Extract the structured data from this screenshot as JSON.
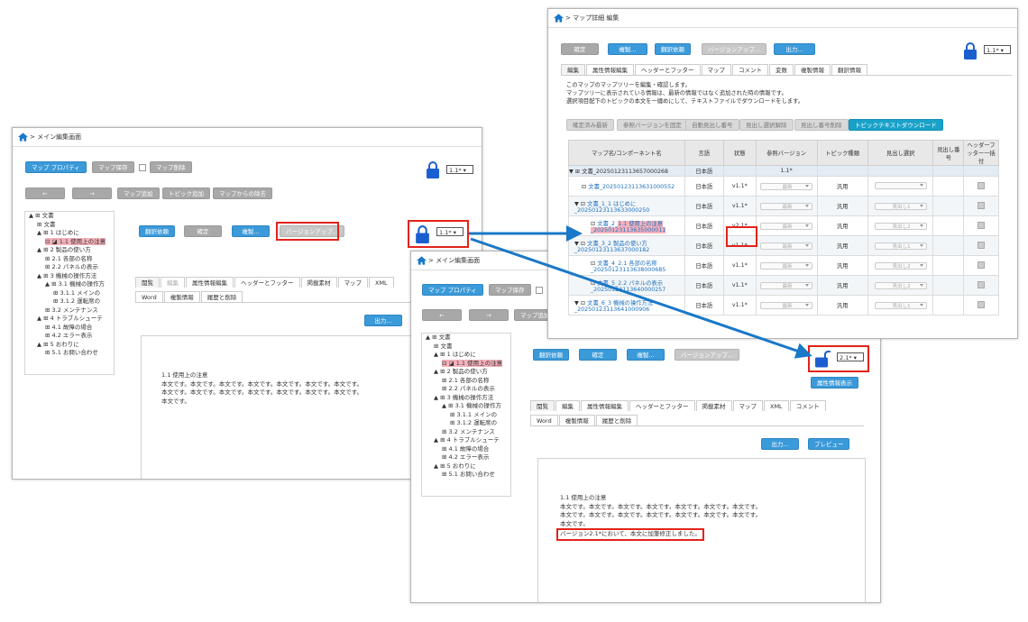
{
  "win1": {
    "title": "メイン編集画面",
    "map_prop": "マップ プロパティ",
    "map_save": "マップ保存",
    "map_delete": "マップ削除",
    "version": "1.1*",
    "back": "←",
    "forward": "→",
    "map_add": "マップ追加",
    "topic_add": "トピック追加",
    "map_remove": "マップからの除去",
    "translate": "翻訳依頼",
    "confirm": "確定",
    "duplicate": "複製...",
    "version_up": "バージョンアップ...",
    "tabs1": [
      "閲覧",
      "編集",
      "属性情報編集",
      "ヘッダーとフッター",
      "掲載素材",
      "マップ",
      "XML"
    ],
    "tabs2": [
      "Word",
      "複製情報",
      "履歴と削除"
    ],
    "output": "出力...",
    "doc_title": "1.1 使用上の注意",
    "doc_lines": [
      "本文です。本文です。本文です。本文です。本文です。本文です。本文です。",
      "本文です。本文です。本文です。本文です。本文です。本文です。本文です。",
      "本文です。"
    ]
  },
  "tree": [
    {
      "indent": 0,
      "label": "▲ ⊞ 文書"
    },
    {
      "indent": 1,
      "label": "⊞ 文書"
    },
    {
      "indent": 1,
      "label": "▲ ⊞ 1 はじめに"
    },
    {
      "indent": 2,
      "label": "1.1 使用上の注意",
      "hl": true
    },
    {
      "indent": 1,
      "label": "▲ ⊞ 2 製品の使い方"
    },
    {
      "indent": 2,
      "label": "⊞ 2.1 各部の名称"
    },
    {
      "indent": 2,
      "label": "⊞ 2.2 パネルの表示"
    },
    {
      "indent": 1,
      "label": "▲ ⊞ 3 機械の操作方法"
    },
    {
      "indent": 2,
      "label": "▲ ⊞ 3.1 機械の操作方"
    },
    {
      "indent": 3,
      "label": "⊞ 3.1.1 メインの"
    },
    {
      "indent": 3,
      "label": "⊞ 3.1.2 運転席の"
    },
    {
      "indent": 2,
      "label": "⊞ 3.2 メンテナンス"
    },
    {
      "indent": 1,
      "label": "▲ ⊞ 4 トラブルシューテ"
    },
    {
      "indent": 2,
      "label": "⊞ 4.1 故障の場合"
    },
    {
      "indent": 2,
      "label": "⊞ 4.2 エラー表示"
    },
    {
      "indent": 1,
      "label": "▲ ⊞ 5 おわりに"
    },
    {
      "indent": 2,
      "label": "⊞ 5.1 お問い合わせ"
    }
  ],
  "win2": {
    "title": "メイン編集画面",
    "map_prop": "マップ プロパティ",
    "map_save": "マップ保存",
    "back": "←",
    "forward": "→",
    "map_add": "マップ追加",
    "translate": "翻訳依頼",
    "confirm": "確定",
    "duplicate": "複製...",
    "version_up": "バージョンアップ...",
    "version": "2.1*",
    "attr_show": "属性情報表示",
    "tabs1": [
      "閲覧",
      "編集",
      "属性情報編集",
      "ヘッダーとフッター",
      "掲載素材",
      "マップ",
      "XML",
      "コメント"
    ],
    "tabs2": [
      "Word",
      "複製情報",
      "履歴と削除"
    ],
    "output": "出力...",
    "preview": "プレビュー",
    "doc_title": "1.1 使用上の注意",
    "doc_lines": [
      "本文です。本文です。本文です。本文です。本文です。本文です。本文です。",
      "本文です。本文です。本文です。本文です。本文です。本文です。本文です。",
      "本文です。"
    ],
    "edited_note": "バージョン2.1*において、本文に加筆修正しました。"
  },
  "win3": {
    "title": "マップ詳細 編集",
    "confirm": "確定",
    "duplicate": "複製...",
    "translate": "翻訳依頼",
    "version_up": "バージョンアップ...",
    "output": "出力...",
    "version": "1.1*",
    "tabs": [
      "編集",
      "属性情報編集",
      "ヘッダーとフッター",
      "マップ",
      "コメント",
      "変数",
      "複製情報",
      "翻訳情報"
    ],
    "desc": [
      "このマップのマップツリーを編集・確認します。",
      "マップツリーに表示されている情報は、最新の情報ではなく追加された時の情報です。",
      "選択項目配下のトピックの本文を一纏めにして、テキストファイルでダウンロードをします。"
    ],
    "actions": [
      "確定済み最新",
      "参照バージョンを固定",
      "自動見出し番号",
      "見出し選択解除",
      "見出し番号削除",
      "トピックテキストダウンロード"
    ],
    "headers": [
      "マップ名/コンポーネント名",
      "言語",
      "状態",
      "参照バージョン",
      "トピック種類",
      "見出し選択",
      "見出し番号",
      "ヘッダーフッター一括付"
    ],
    "rows": [
      {
        "name": "文書_20250123113657000268",
        "lang": "日本語",
        "state": "",
        "ref": "1.1*",
        "type": "",
        "head": "",
        "num": ""
      },
      {
        "name": "文書_20250123113631000552",
        "lang": "日本語",
        "state": "v1.1*",
        "ref": "最新",
        "type": "汎用",
        "head": "",
        "num": ""
      },
      {
        "name": "文書_1_1 はじめに_20250123113633000250",
        "lang": "日本語",
        "state": "v1.1*",
        "ref": "最新",
        "type": "汎用",
        "head": "見出し1",
        "num": ""
      },
      {
        "name_a": "文書_2_",
        "name_b": "1.1 使用上の注意_20250123113635000011",
        "lang": "日本語",
        "state": "v2.1*",
        "ref": "最新",
        "type": "汎用",
        "head": "見出し2",
        "num": ""
      },
      {
        "name": "文書_3_2 製品の使い方_20250123113637000182",
        "lang": "日本語",
        "state": "v1.1*",
        "ref": "最新",
        "type": "汎用",
        "head": "見出し1",
        "num": ""
      },
      {
        "name": "文書_4_2.1 各部の名称_20250123113638000685",
        "lang": "日本語",
        "state": "v1.1*",
        "ref": "最新",
        "type": "汎用",
        "head": "見出し2",
        "num": ""
      },
      {
        "name": "文書_5_2.2 パネルの表示_20250123113640000257",
        "lang": "日本語",
        "state": "v1.1*",
        "ref": "最新",
        "type": "汎用",
        "head": "見出し2",
        "num": ""
      },
      {
        "name": "文書_6_3 機械の操作方法_20250123113641000906",
        "lang": "日本語",
        "state": "v1.1*",
        "ref": "最新",
        "type": "汎用",
        "head": "見出し1",
        "num": ""
      }
    ]
  },
  "colors": {
    "accent": "#3b9ad9",
    "arrow": "#1a78c8",
    "highlight": "#e2231a",
    "lock": "#1a5fd0"
  }
}
